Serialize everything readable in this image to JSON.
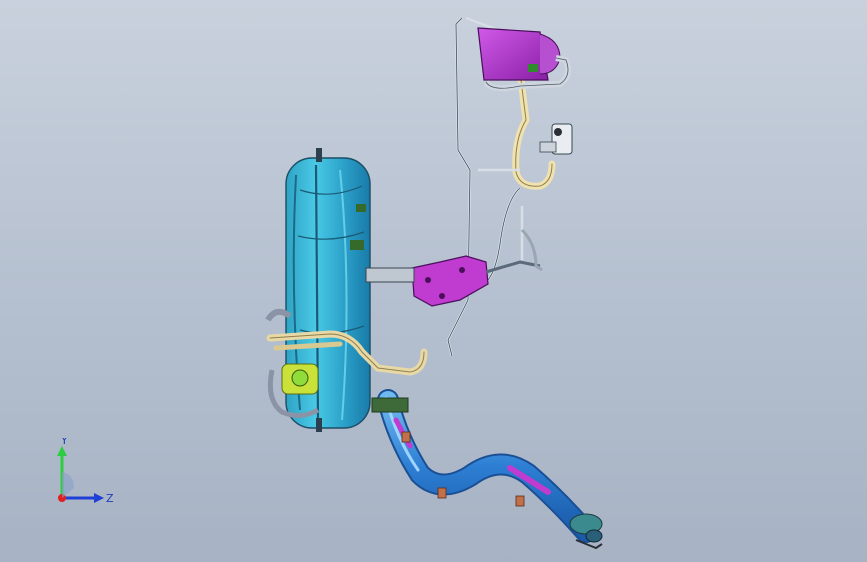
{
  "viewport": {
    "background_top": "#c9d1dd",
    "background_bottom": "#a7b3c4"
  },
  "triad": {
    "y_label": "Y",
    "z_label": "Z",
    "y_color": "#2ecc40",
    "z_color": "#1f3fd6",
    "x_color": "#e02020"
  },
  "parts": {
    "fuel_tank_color": "#35b7d6",
    "canister_color": "#b52fd0",
    "bracket_color": "#c03bcf",
    "filler_pipe_color": "#2f86d8",
    "vent_line_color": "#e7d8a5"
  }
}
